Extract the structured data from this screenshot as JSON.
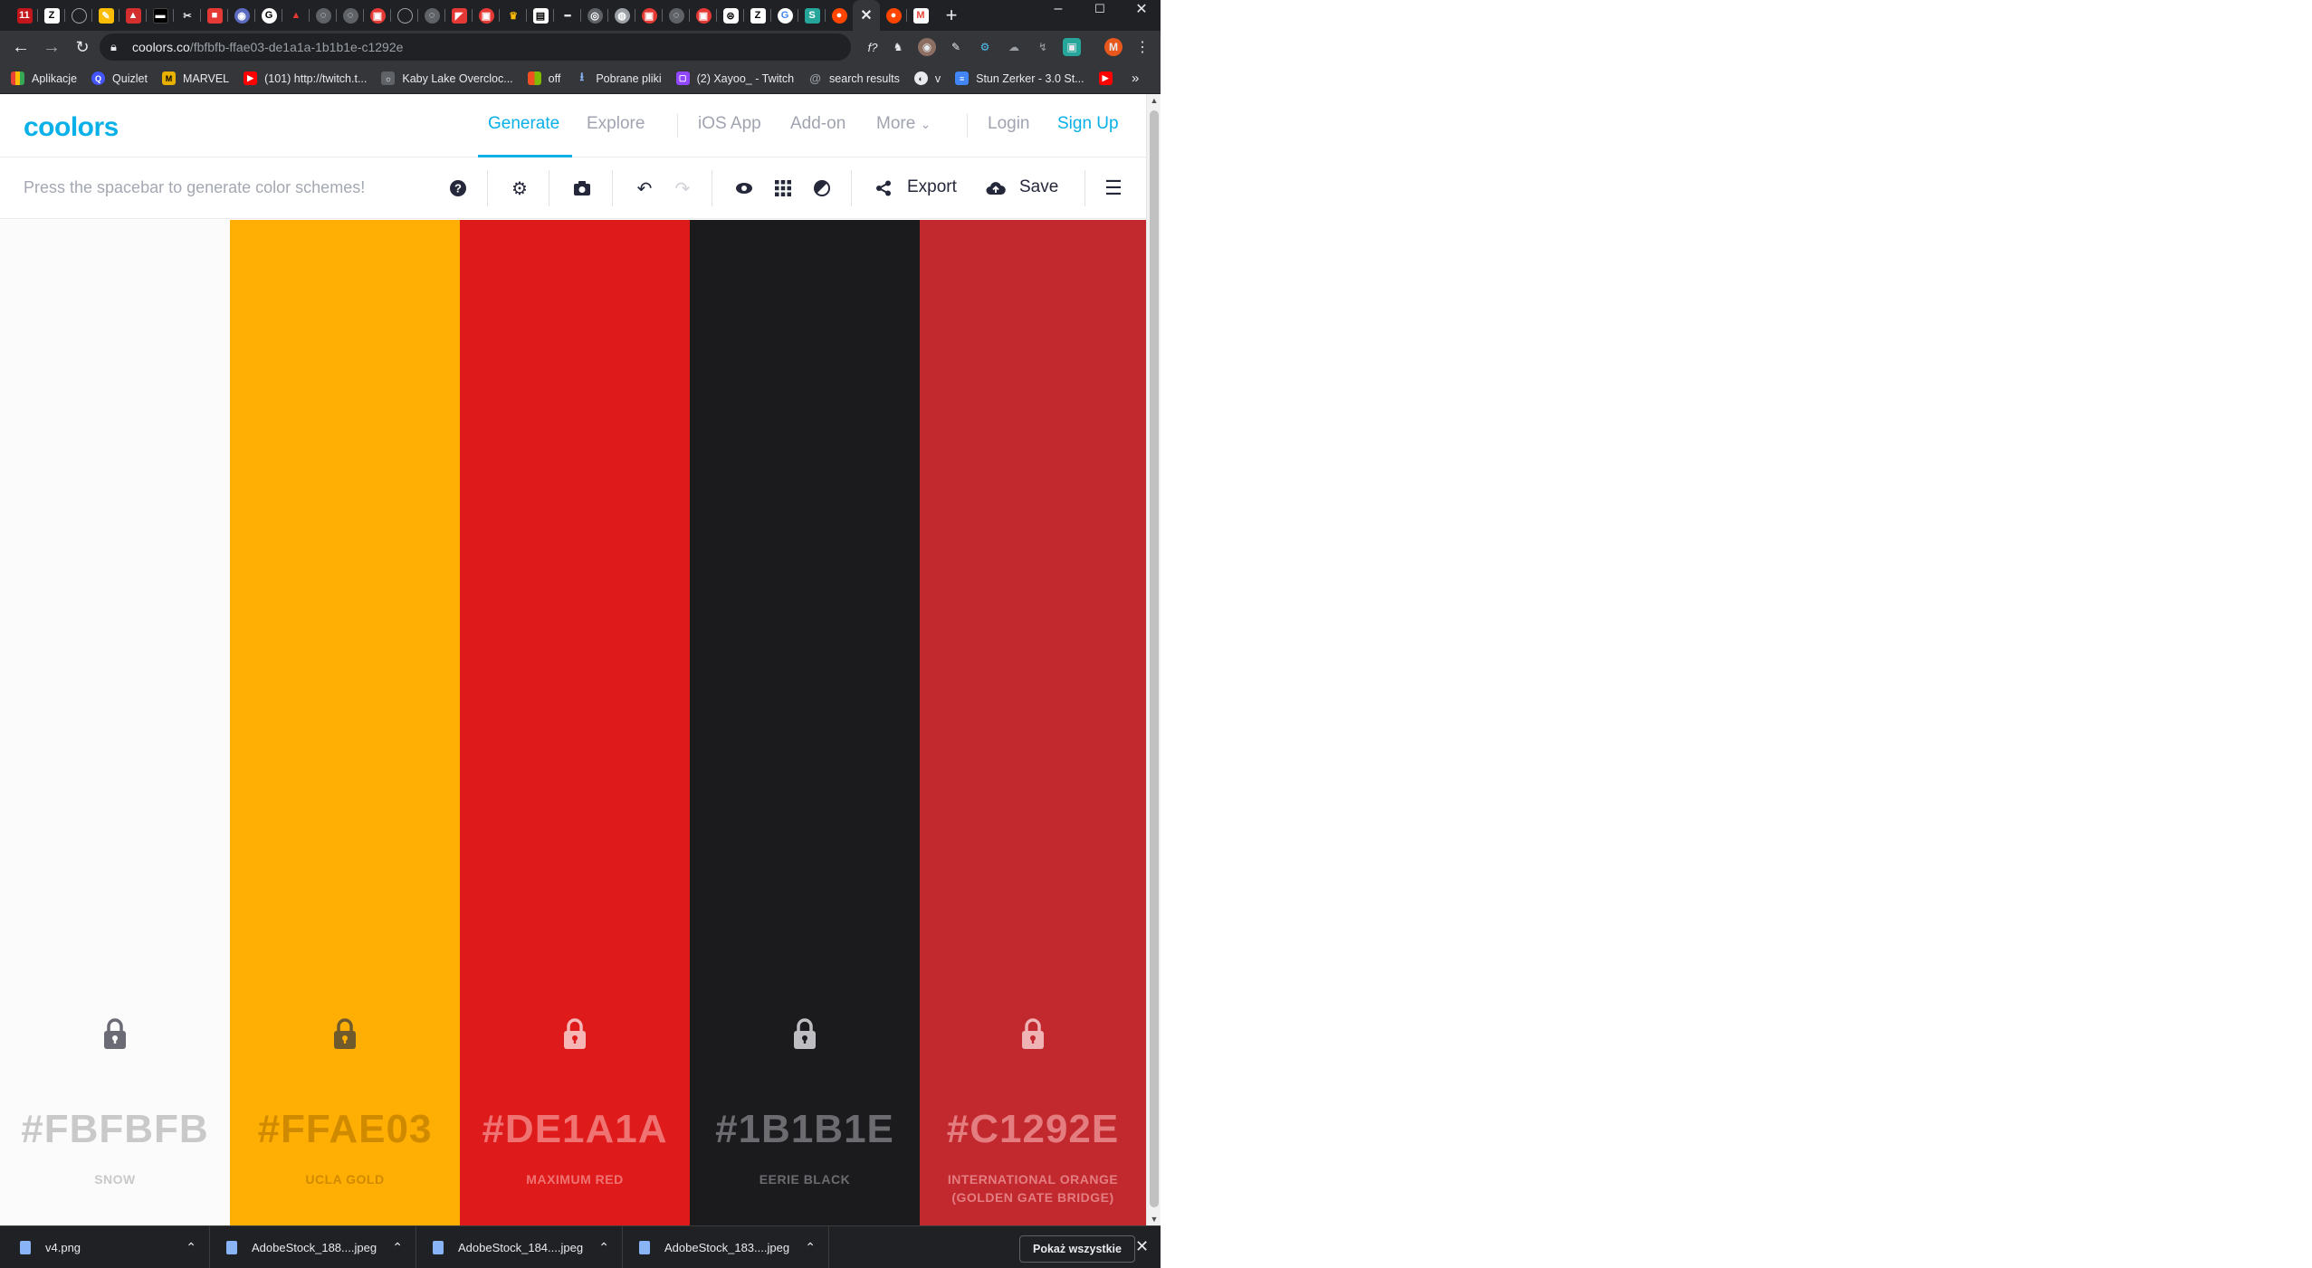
{
  "browser": {
    "url_host": "coolors.co",
    "url_path": "/fbfbfb-ffae03-de1a1a-1b1b1e-c1292e",
    "bookmarks": [
      {
        "label": "Aplikacje",
        "color": "#ea4335"
      },
      {
        "label": "Quizlet",
        "color": "#4255ff"
      },
      {
        "label": "MARVEL",
        "color": "#e8b100"
      },
      {
        "label": "(101) http://twitch.t...",
        "color": "#ff0000"
      },
      {
        "label": "Kaby Lake Overcloc...",
        "color": "#5f6368"
      },
      {
        "label": "off",
        "color": "#f25022"
      },
      {
        "label": "Pobrane pliki",
        "color": "#8ab4f8"
      },
      {
        "label": "(2) Xayoo_ - Twitch",
        "color": "#9146ff"
      },
      {
        "label": "search results",
        "color": "#9aa0a6"
      },
      {
        "label": "v",
        "color": "#5f6368"
      },
      {
        "label": "Stun Zerker - 3.0 St...",
        "color": "#4285f4"
      }
    ],
    "more_bookmarks_icon": "»",
    "profile_initial": "M"
  },
  "nav": {
    "logo": "coolors",
    "generate": "Generate",
    "explore": "Explore",
    "ios_app": "iOS App",
    "addon": "Add-on",
    "more": "More",
    "login": "Login",
    "signup": "Sign Up"
  },
  "controls": {
    "hint": "Press the spacebar to generate color schemes!",
    "export": "Export",
    "save": "Save",
    "icons": [
      "help-icon",
      "settings-icon",
      "camera-icon",
      "undo-icon",
      "redo-icon",
      "view-icon",
      "grid-icon",
      "adjust-icon",
      "share-icon",
      "cloud-upload-icon",
      "menu-icon"
    ]
  },
  "palette": [
    {
      "hex": "#FBFBFB",
      "name": "SNOW",
      "bg": "#fbfbfb",
      "fg": "#c9c9c9",
      "lock": "#6b6b75"
    },
    {
      "hex": "#FFAE03",
      "name": "UCLA GOLD",
      "bg": "#ffae03",
      "fg": "#d08a00",
      "lock": "#6e5a2d"
    },
    {
      "hex": "#DE1A1A",
      "name": "MAXIMUM RED",
      "bg": "#de1a1a",
      "fg": "#f07373",
      "lock": "#f6b6b6"
    },
    {
      "hex": "#1B1B1E",
      "name": "EERIE BLACK",
      "bg": "#1b1b1e",
      "fg": "#6b6b70",
      "lock": "#bdbdc2"
    },
    {
      "hex": "#C1292E",
      "name": "INTERNATIONAL ORANGE (GOLDEN GATE BRIDGE)",
      "bg": "#c1292e",
      "fg": "#e47d80",
      "lock": "#f0b3b5"
    }
  ],
  "downloads": {
    "items": [
      "v4.png",
      "AdobeStock_188....jpeg",
      "AdobeStock_184....jpeg",
      "AdobeStock_183....jpeg"
    ],
    "show_all": "Pokaż wszystkie"
  }
}
